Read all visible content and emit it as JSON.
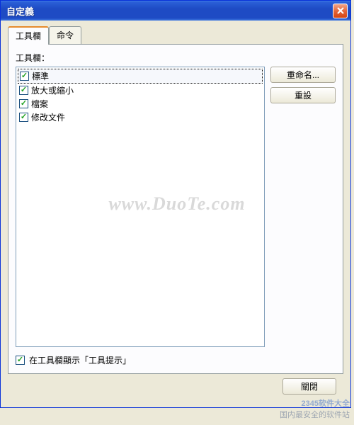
{
  "window": {
    "title": "自定義"
  },
  "tabs": {
    "toolbar": "工具欄",
    "commands": "命令"
  },
  "panel": {
    "label": "工具欄：",
    "items": [
      {
        "label": "標準",
        "checked": true,
        "selected": true
      },
      {
        "label": "放大或縮小",
        "checked": true,
        "selected": false
      },
      {
        "label": "檔案",
        "checked": true,
        "selected": false
      },
      {
        "label": "修改文件",
        "checked": true,
        "selected": false
      }
    ],
    "rename_btn": "重命名...",
    "reset_btn": "重設",
    "show_tooltips_label": "在工具欄顯示「工具提示」",
    "show_tooltips_checked": true
  },
  "footer": {
    "close_btn": "關閉"
  },
  "watermark": "www.DuoTe.com",
  "badge": {
    "line1": "2345软件大全",
    "line2": "国内最安全的软件站"
  }
}
